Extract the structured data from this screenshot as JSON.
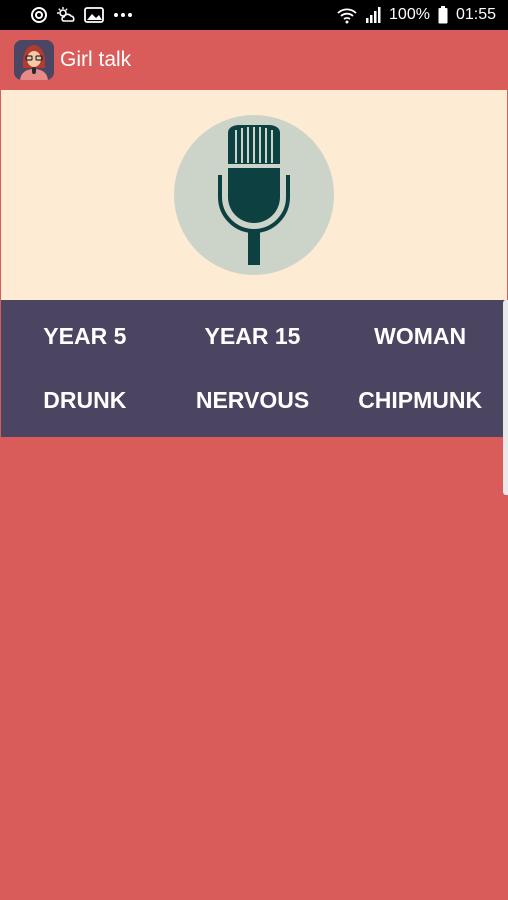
{
  "status_bar": {
    "battery": "100%",
    "time": "01:55",
    "left_icons": [
      "sync-icon",
      "sun-cloud-icon",
      "image-icon",
      "more-dots-icon"
    ],
    "right_icons": [
      "wifi-icon",
      "signal-icon",
      "battery-icon"
    ]
  },
  "app_bar": {
    "title": "Girl talk",
    "icon": "girl-avatar-icon"
  },
  "mic": {
    "icon": "microphone-icon"
  },
  "effects": [
    {
      "label": "YEAR 5"
    },
    {
      "label": "YEAR 15"
    },
    {
      "label": "WOMAN"
    },
    {
      "label": "DRUNK"
    },
    {
      "label": "NERVOUS"
    },
    {
      "label": "CHIPMUNK"
    }
  ],
  "colors": {
    "background": "#d95c5b",
    "mic_panel": "#fdebd3",
    "mic_circle": "#ccd3c8",
    "mic": "#0d4040",
    "effects_panel": "#4b4562"
  }
}
